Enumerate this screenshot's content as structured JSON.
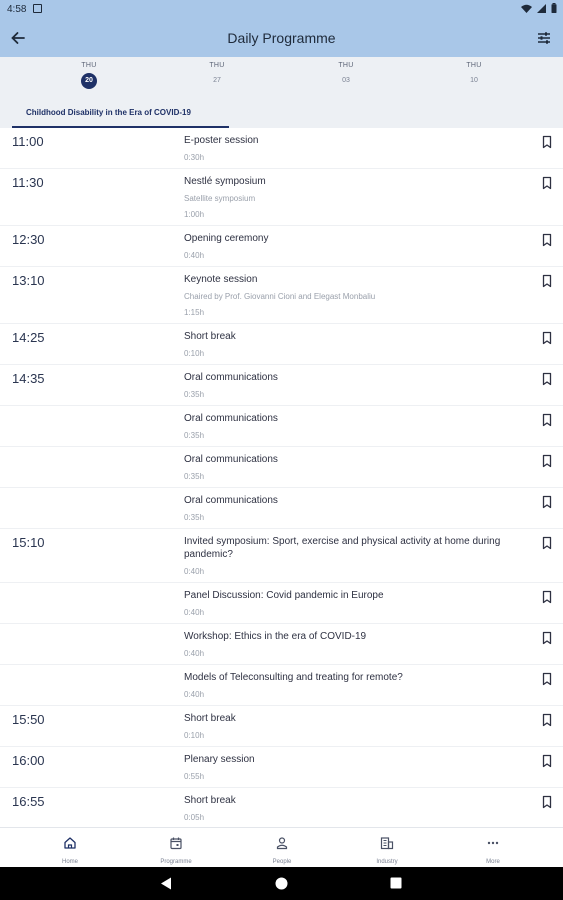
{
  "status_bar": {
    "time": "4:58"
  },
  "header": {
    "title": "Daily Programme"
  },
  "dates": [
    {
      "dow": "THU",
      "day": "20",
      "active": true
    },
    {
      "dow": "THU",
      "day": "27",
      "active": false
    },
    {
      "dow": "THU",
      "day": "03",
      "active": false
    },
    {
      "dow": "THU",
      "day": "10",
      "active": false
    }
  ],
  "track": {
    "label": "Childhood Disability in the Era of COVID-19"
  },
  "sessions": [
    {
      "time": "11:00",
      "title": "E-poster session",
      "subtitle": "",
      "duration": "0:30h"
    },
    {
      "time": "11:30",
      "title": "Nestlé symposium",
      "subtitle": "Satellite symposium",
      "duration": "1:00h"
    },
    {
      "time": "12:30",
      "title": "Opening ceremony",
      "subtitle": "",
      "duration": "0:40h"
    },
    {
      "time": "13:10",
      "title": "Keynote session",
      "subtitle": "Chaired by Prof. Giovanni Cioni and Elegast Monbaliu",
      "duration": "1:15h"
    },
    {
      "time": "14:25",
      "title": "Short break",
      "subtitle": "",
      "duration": "0:10h"
    },
    {
      "time": "14:35",
      "title": "Oral communications",
      "subtitle": "",
      "duration": "0:35h"
    },
    {
      "time": "",
      "title": "Oral communications",
      "subtitle": "",
      "duration": "0:35h"
    },
    {
      "time": "",
      "title": "Oral communications",
      "subtitle": "",
      "duration": "0:35h"
    },
    {
      "time": "",
      "title": "Oral communications",
      "subtitle": "",
      "duration": "0:35h"
    },
    {
      "time": "15:10",
      "title": "Invited symposium: Sport, exercise and physical activity at home during pandemic?",
      "subtitle": "",
      "duration": "0:40h"
    },
    {
      "time": "",
      "title": "Panel Discussion: Covid pandemic in Europe",
      "subtitle": "",
      "duration": "0:40h"
    },
    {
      "time": "",
      "title": "Workshop: Ethics in the era of COVID-19",
      "subtitle": "",
      "duration": "0:40h"
    },
    {
      "time": "",
      "title": "Models of Teleconsulting and treating for remote?",
      "subtitle": "",
      "duration": "0:40h"
    },
    {
      "time": "15:50",
      "title": "Short break",
      "subtitle": "",
      "duration": "0:10h"
    },
    {
      "time": "16:00",
      "title": "Plenary session",
      "subtitle": "",
      "duration": "0:55h"
    },
    {
      "time": "16:55",
      "title": "Short break",
      "subtitle": "",
      "duration": "0:05h"
    }
  ],
  "bottom_nav": [
    {
      "label": "Home",
      "icon": "home-icon"
    },
    {
      "label": "Programme",
      "icon": "calendar-icon"
    },
    {
      "label": "People",
      "icon": "person-icon"
    },
    {
      "label": "Industry",
      "icon": "building-icon"
    },
    {
      "label": "More",
      "icon": "more-icon"
    }
  ],
  "colors": {
    "appbar": "#a9c7e8",
    "accent": "#1f3167",
    "strip": "#edf0f4"
  }
}
